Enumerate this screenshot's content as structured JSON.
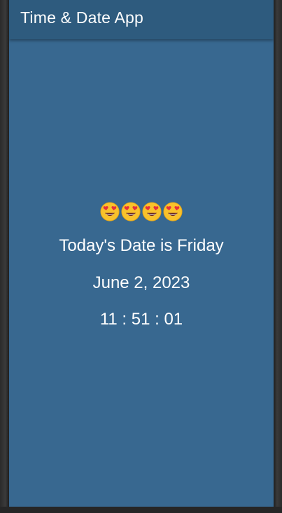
{
  "app_bar": {
    "title": "Time & Date App",
    "background": "#2e5b7e"
  },
  "screen": {
    "background": "#386890"
  },
  "content": {
    "emojis": [
      "smiling-face-with-heart-eyes",
      "smiling-face-with-heart-eyes",
      "smiling-face-with-heart-eyes",
      "smiling-face-with-heart-eyes"
    ],
    "day_text": "Today's Date is Friday",
    "date_text": "June 2, 2023",
    "time_text": "11 : 51 : 01"
  }
}
